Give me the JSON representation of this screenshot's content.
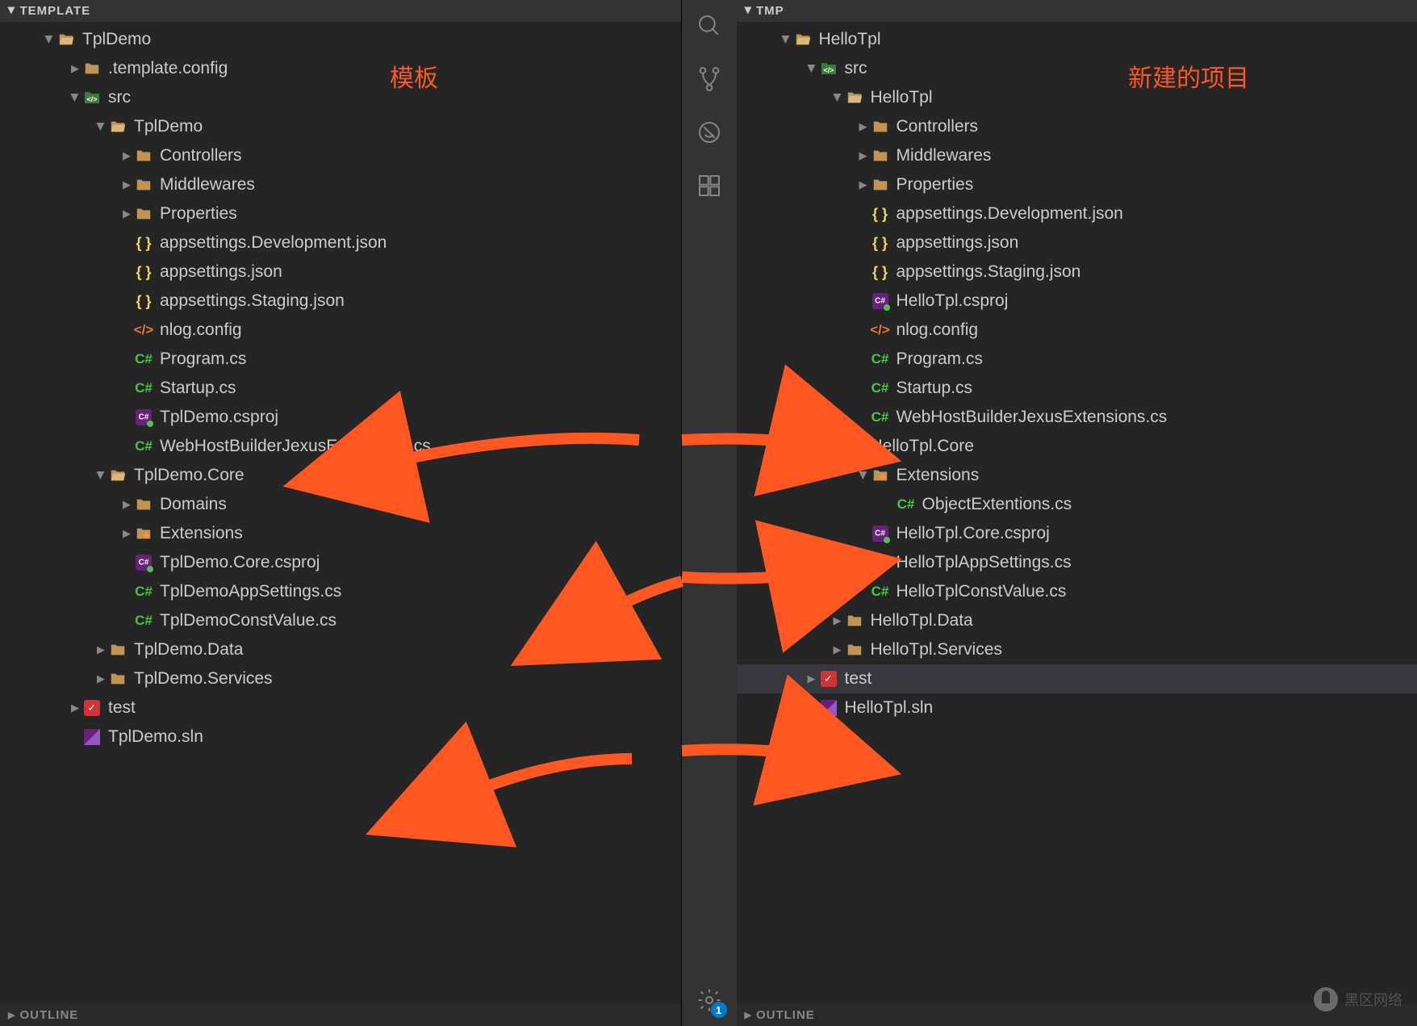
{
  "left": {
    "header": "TEMPLATE",
    "annotation": "模板",
    "outline": "OUTLINE",
    "tree": [
      {
        "d": 1,
        "exp": true,
        "icon": "folder-open",
        "label": "TplDemo"
      },
      {
        "d": 2,
        "exp": false,
        "icon": "folder",
        "label": ".template.config"
      },
      {
        "d": 2,
        "exp": true,
        "icon": "src",
        "label": "src"
      },
      {
        "d": 3,
        "exp": true,
        "icon": "folder-open",
        "label": "TplDemo"
      },
      {
        "d": 4,
        "exp": false,
        "icon": "folder",
        "label": "Controllers"
      },
      {
        "d": 4,
        "exp": false,
        "icon": "folder",
        "label": "Middlewares"
      },
      {
        "d": 4,
        "exp": false,
        "icon": "folder",
        "label": "Properties"
      },
      {
        "d": 4,
        "icon": "braces",
        "label": "appsettings.Development.json"
      },
      {
        "d": 4,
        "icon": "braces",
        "label": "appsettings.json"
      },
      {
        "d": 4,
        "icon": "braces",
        "label": "appsettings.Staging.json"
      },
      {
        "d": 4,
        "icon": "xml",
        "label": "nlog.config"
      },
      {
        "d": 4,
        "icon": "cs",
        "label": "Program.cs"
      },
      {
        "d": 4,
        "icon": "cs",
        "label": "Startup.cs"
      },
      {
        "d": 4,
        "icon": "csproj",
        "label": "TplDemo.csproj"
      },
      {
        "d": 4,
        "icon": "cs",
        "label": "WebHostBuilderJexusExtensions.cs"
      },
      {
        "d": 3,
        "exp": true,
        "icon": "folder-open",
        "label": "TplDemo.Core"
      },
      {
        "d": 4,
        "exp": false,
        "icon": "folder",
        "label": "Domains"
      },
      {
        "d": 4,
        "exp": false,
        "icon": "ext",
        "label": "Extensions"
      },
      {
        "d": 4,
        "icon": "csproj",
        "label": "TplDemo.Core.csproj"
      },
      {
        "d": 4,
        "icon": "cs",
        "label": "TplDemoAppSettings.cs"
      },
      {
        "d": 4,
        "icon": "cs",
        "label": "TplDemoConstValue.cs"
      },
      {
        "d": 3,
        "exp": false,
        "icon": "folder",
        "label": "TplDemo.Data"
      },
      {
        "d": 3,
        "exp": false,
        "icon": "folder",
        "label": "TplDemo.Services"
      },
      {
        "d": 2,
        "exp": false,
        "icon": "test",
        "label": "test"
      },
      {
        "d": 2,
        "icon": "sln",
        "label": "TplDemo.sln"
      }
    ]
  },
  "right": {
    "header": "TMP",
    "annotation": "新建的项目",
    "outline": "OUTLINE",
    "tree": [
      {
        "d": 1,
        "exp": true,
        "icon": "folder-open",
        "label": "HelloTpl"
      },
      {
        "d": 2,
        "exp": true,
        "icon": "src",
        "label": "src"
      },
      {
        "d": 3,
        "exp": true,
        "icon": "folder-open",
        "label": "HelloTpl"
      },
      {
        "d": 4,
        "exp": false,
        "icon": "folder",
        "label": "Controllers"
      },
      {
        "d": 4,
        "exp": false,
        "icon": "folder",
        "label": "Middlewares"
      },
      {
        "d": 4,
        "exp": false,
        "icon": "folder",
        "label": "Properties"
      },
      {
        "d": 4,
        "icon": "braces",
        "label": "appsettings.Development.json"
      },
      {
        "d": 4,
        "icon": "braces",
        "label": "appsettings.json"
      },
      {
        "d": 4,
        "icon": "braces",
        "label": "appsettings.Staging.json"
      },
      {
        "d": 4,
        "icon": "csproj",
        "label": "HelloTpl.csproj"
      },
      {
        "d": 4,
        "icon": "xml",
        "label": "nlog.config"
      },
      {
        "d": 4,
        "icon": "cs",
        "label": "Program.cs"
      },
      {
        "d": 4,
        "icon": "cs",
        "label": "Startup.cs"
      },
      {
        "d": 4,
        "icon": "cs",
        "label": "WebHostBuilderJexusExtensions.cs"
      },
      {
        "d": 3,
        "exp": true,
        "icon": "folder-open",
        "label": "HelloTpl.Core"
      },
      {
        "d": 4,
        "exp": true,
        "icon": "ext",
        "label": "Extensions"
      },
      {
        "d": 5,
        "icon": "cs",
        "label": "ObjectExtentions.cs"
      },
      {
        "d": 4,
        "icon": "csproj",
        "label": "HelloTpl.Core.csproj"
      },
      {
        "d": 4,
        "icon": "cs",
        "label": "HelloTplAppSettings.cs"
      },
      {
        "d": 4,
        "icon": "cs",
        "label": "HelloTplConstValue.cs"
      },
      {
        "d": 3,
        "exp": false,
        "icon": "folder",
        "label": "HelloTpl.Data"
      },
      {
        "d": 3,
        "exp": false,
        "icon": "folder",
        "label": "HelloTpl.Services"
      },
      {
        "d": 2,
        "exp": false,
        "icon": "test",
        "label": "test",
        "selected": true
      },
      {
        "d": 2,
        "icon": "sln",
        "label": "HelloTpl.sln"
      }
    ]
  },
  "activity_badge": "1",
  "watermark": "黑区网络"
}
